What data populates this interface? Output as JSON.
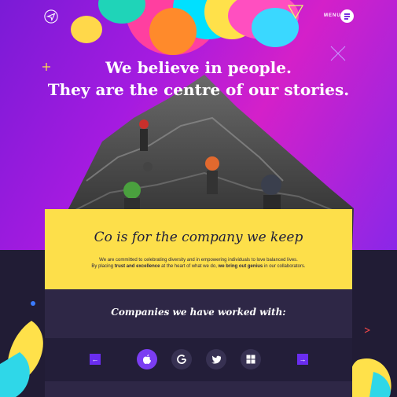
{
  "header": {
    "menu_label": "MENU",
    "logo": "paper-plane-icon",
    "menu_icon": "menu-icon"
  },
  "hero": {
    "line1": "We believe in people.",
    "line2": "They are the centre of our stories."
  },
  "card": {
    "title": "Co is for the company we keep",
    "text_line1": "We are committed to celebrating diversity and in empowering individuals to love balanced lives.",
    "text_line2_prefix": "By placing ",
    "text_line2_bold1": "trust and excellence",
    "text_line2_mid": " at the heart of what we do, ",
    "text_line2_bold2": "we bring out genius",
    "text_line2_suffix": " in our collaborators."
  },
  "companies": {
    "title": "Companies we have worked with:",
    "prev_label": "←",
    "next_label": "→",
    "items": [
      {
        "name": "apple-icon",
        "active": true
      },
      {
        "name": "google-icon",
        "active": false
      },
      {
        "name": "twitter-icon",
        "active": false
      },
      {
        "name": "windows-icon",
        "active": false
      }
    ]
  },
  "colors": {
    "accent": "#7b3df2",
    "yellow": "#fddf4a",
    "dark": "#211c35"
  }
}
